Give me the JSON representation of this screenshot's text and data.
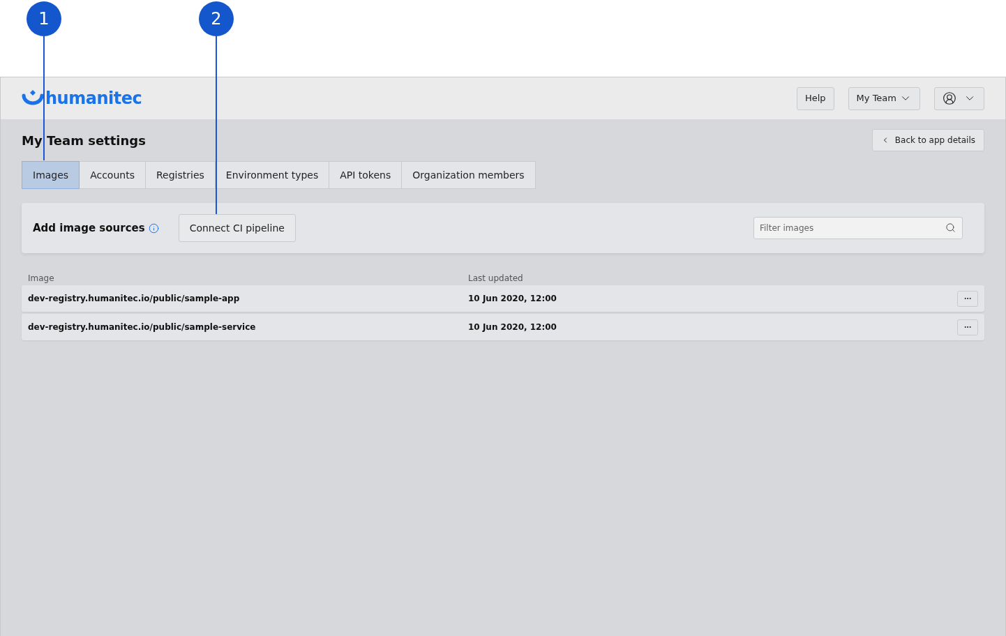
{
  "callouts": [
    {
      "label": "1"
    },
    {
      "label": "2"
    }
  ],
  "header": {
    "logo": "humanitec",
    "buttons": [
      {
        "label": "Help",
        "kind": "plain"
      },
      {
        "label": "My Team",
        "kind": "dropdown"
      },
      {
        "kind": "user"
      }
    ]
  },
  "page": {
    "title": "My Team settings",
    "back_button": "Back to app details"
  },
  "tabs": [
    {
      "label": "Images",
      "selected": true
    },
    {
      "label": "Accounts",
      "selected": false
    },
    {
      "label": "Registries",
      "selected": false
    },
    {
      "label": "Environment types",
      "selected": false
    },
    {
      "label": "API tokens",
      "selected": false
    },
    {
      "label": "Organization members",
      "selected": false
    }
  ],
  "sources_panel": {
    "title": "Add image sources",
    "button": "Connect CI pipeline",
    "search": {
      "placeholder": "Filter images"
    }
  },
  "table": {
    "columns": [
      "Image",
      "Last updated"
    ],
    "rows": [
      {
        "image": "dev-registry.humanitec.io/public/sample-app",
        "updated": "10 Jun 2020, 12:00"
      },
      {
        "image": "dev-registry.humanitec.io/public/sample-service",
        "updated": "10 Jun 2020, 12:00"
      }
    ]
  }
}
